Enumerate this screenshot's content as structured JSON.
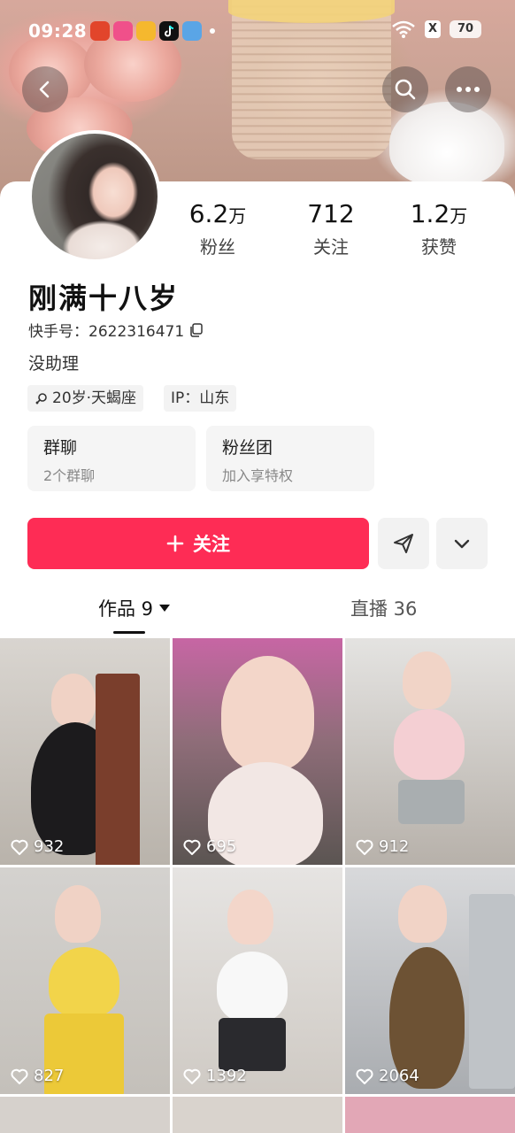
{
  "status_bar": {
    "time": "09:28",
    "battery": "70",
    "sim_label": "X"
  },
  "nav": {
    "back_icon": "chevron-left-icon",
    "search_icon": "search-icon",
    "more_icon": "more-dots-icon"
  },
  "profile": {
    "stats": [
      {
        "value": "6.2",
        "unit": "万",
        "label": "粉丝"
      },
      {
        "value": "712",
        "unit": "",
        "label": "关注"
      },
      {
        "value": "1.2",
        "unit": "万",
        "label": "获赞"
      }
    ],
    "name": "刚满十八岁",
    "kuaishou_id": "快手号：2622316471",
    "bio": "没助理",
    "tags": [
      "20岁·天蝎座",
      "IP：山东"
    ],
    "quick_cards": [
      {
        "title": "群聊",
        "subtitle": "2个群聊"
      },
      {
        "title": "粉丝团",
        "subtitle": "加入享特权"
      }
    ],
    "follow_label": "关注"
  },
  "tabs": [
    {
      "label": "作品 9",
      "active": true
    },
    {
      "label": "直播 36",
      "active": false
    }
  ],
  "videos": [
    {
      "likes": "932"
    },
    {
      "likes": "695"
    },
    {
      "likes": "912"
    },
    {
      "likes": "827"
    },
    {
      "likes": "1392"
    },
    {
      "likes": "2064"
    }
  ],
  "colors": {
    "accent": "#fe2c55"
  }
}
